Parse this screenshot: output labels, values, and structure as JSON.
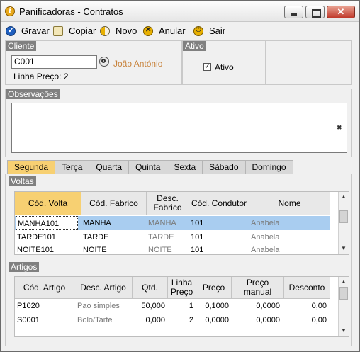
{
  "window": {
    "title": "Panificadoras - Contratos",
    "close_glyph": "✕"
  },
  "toolbar": {
    "gravar": {
      "u": "G",
      "rest": "ravar",
      "icon": "check-circle-icon"
    },
    "copiar": {
      "pre": "Cop",
      "u": "i",
      "rest": "ar",
      "icon": "copy-icon"
    },
    "novo": {
      "u": "N",
      "rest": "ovo",
      "icon": "new-icon"
    },
    "anular": {
      "u": "A",
      "rest": "nular",
      "icon": "cancel-icon"
    },
    "sair": {
      "u": "S",
      "rest": "air",
      "icon": "power-icon"
    }
  },
  "cliente": {
    "title": "Cliente",
    "code": "C001",
    "name": "João António",
    "price_line": "Linha Preço: 2",
    "lookup_icon": "search-icon"
  },
  "ativo": {
    "title": "Ativo",
    "label": "Ativo",
    "checked": true
  },
  "observacoes": {
    "title": "Observações",
    "value": "",
    "clear_glyph": "✖"
  },
  "tabs": [
    "Segunda",
    "Terça",
    "Quarta",
    "Quinta",
    "Sexta",
    "Sábado",
    "Domingo"
  ],
  "voltas": {
    "title": "Voltas",
    "headers": [
      "Cód. Volta",
      "Cód. Fabrico",
      "Desc. Fabrico",
      "Cód. Condutor",
      "Nome"
    ],
    "rows": [
      [
        "MANHA101",
        "MANHA",
        "MANHA",
        "101",
        "Anabela"
      ],
      [
        "TARDE101",
        "TARDE",
        "TARDE",
        "101",
        "Anabela"
      ],
      [
        "NOITE101",
        "NOITE",
        "NOITE",
        "101",
        "Anabela"
      ]
    ],
    "selected_row": 0
  },
  "artigos": {
    "title": "Artigos",
    "headers": [
      "Cód. Artigo",
      "Desc. Artigo",
      "Qtd.",
      "Linha Preço",
      "Preço",
      "Preço manual",
      "Desconto"
    ],
    "rows": [
      [
        "P1020",
        "Pao simples",
        "50,000",
        "1",
        "0,1000",
        "0,0000",
        "0,00"
      ],
      [
        "S0001",
        "Bolo/Tarte",
        "0,000",
        "2",
        "0,0000",
        "0,0000",
        "0,00"
      ]
    ]
  },
  "colors": {
    "accent": "#f7d072",
    "selection": "#a9cdf0",
    "link_orange": "#c8823a"
  }
}
